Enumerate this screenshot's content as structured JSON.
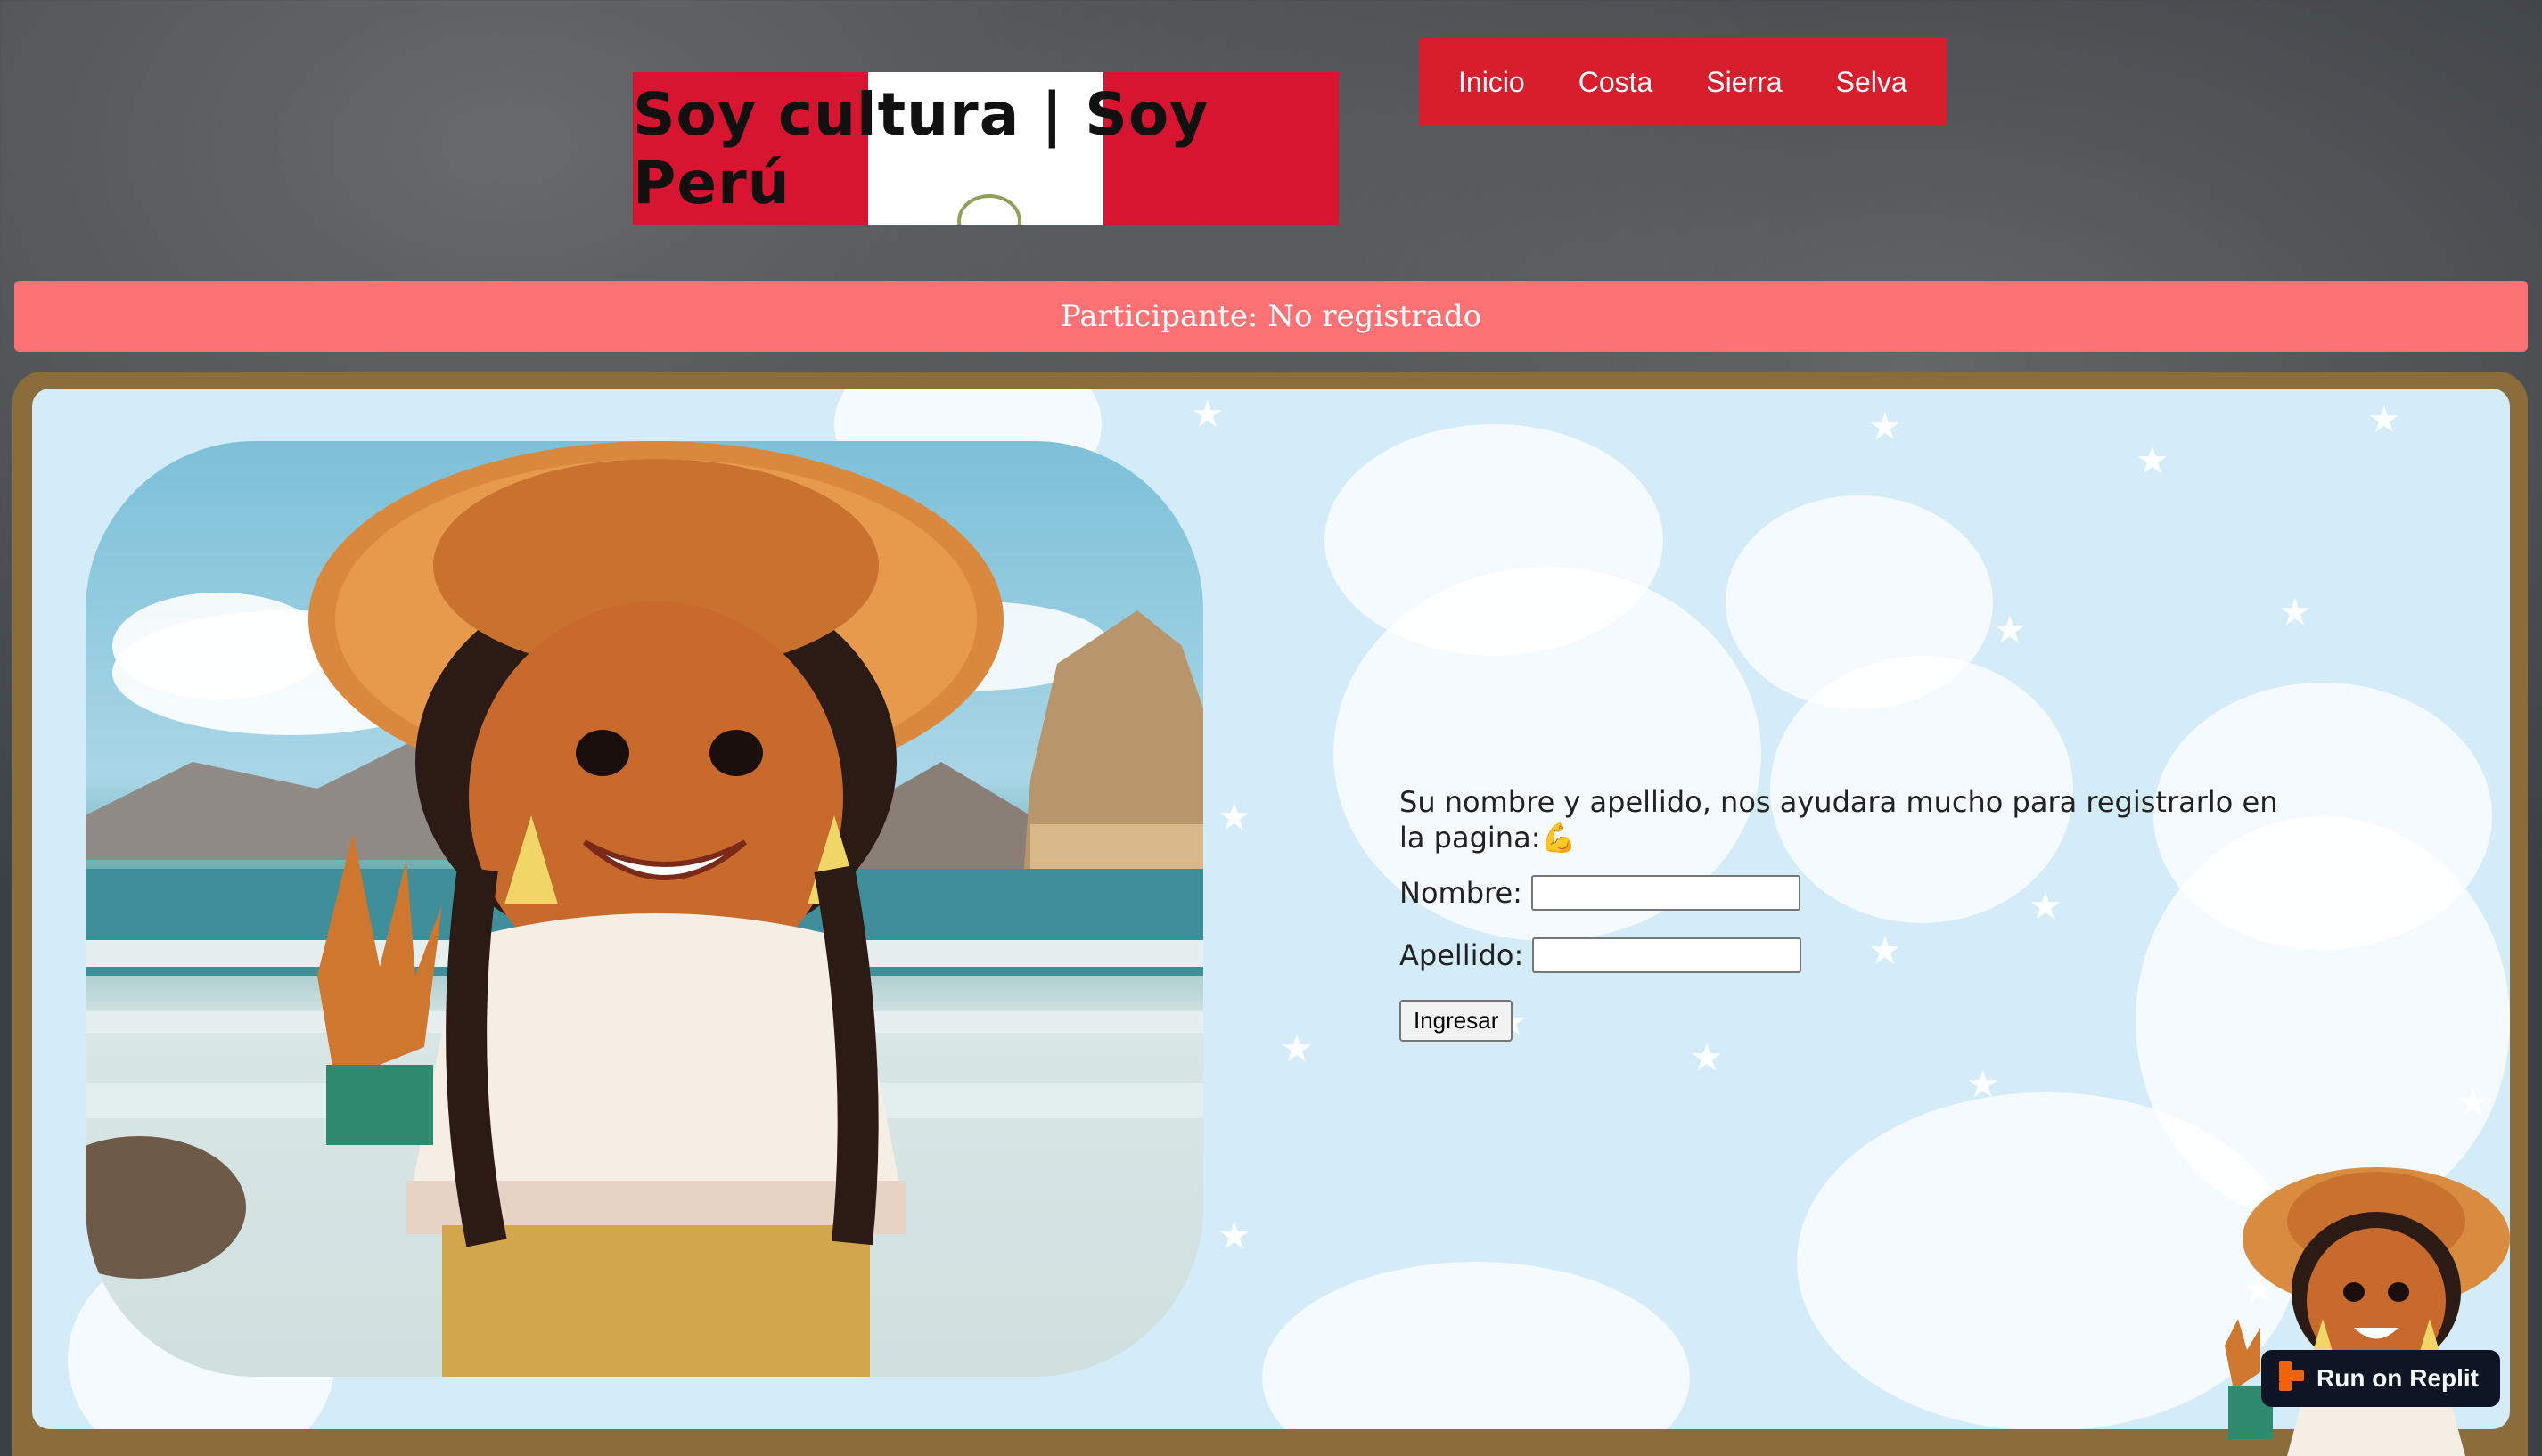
{
  "header": {
    "logo_text": "Soy cultura | Soy Perú",
    "nav": [
      {
        "label": "Inicio"
      },
      {
        "label": "Costa"
      },
      {
        "label": "Sierra"
      },
      {
        "label": "Selva"
      }
    ]
  },
  "participant": {
    "status_text": "Participante: No registrado"
  },
  "form": {
    "intro_text": "Su nombre y apellido, nos ayudara mucho para registrarlo en la pagina:💪",
    "first_name_label": "Nombre:",
    "first_name_value": "",
    "last_name_label": "Apellido:",
    "last_name_value": "",
    "submit_label": "Ingresar"
  },
  "badge": {
    "label": "Run on Replit",
    "icon": "replit-icon"
  },
  "colors": {
    "flag_red": "#d81530",
    "nav_red": "#d81d2c",
    "status_bar": "#fc7274",
    "panel_frame": "#8a6d3b",
    "panel_bg": "#d3ecf8",
    "badge_bg": "#0e1525"
  },
  "images": {
    "hero": "girl-waving-beach-illustration",
    "mascot": "girl-mascot-corner"
  }
}
